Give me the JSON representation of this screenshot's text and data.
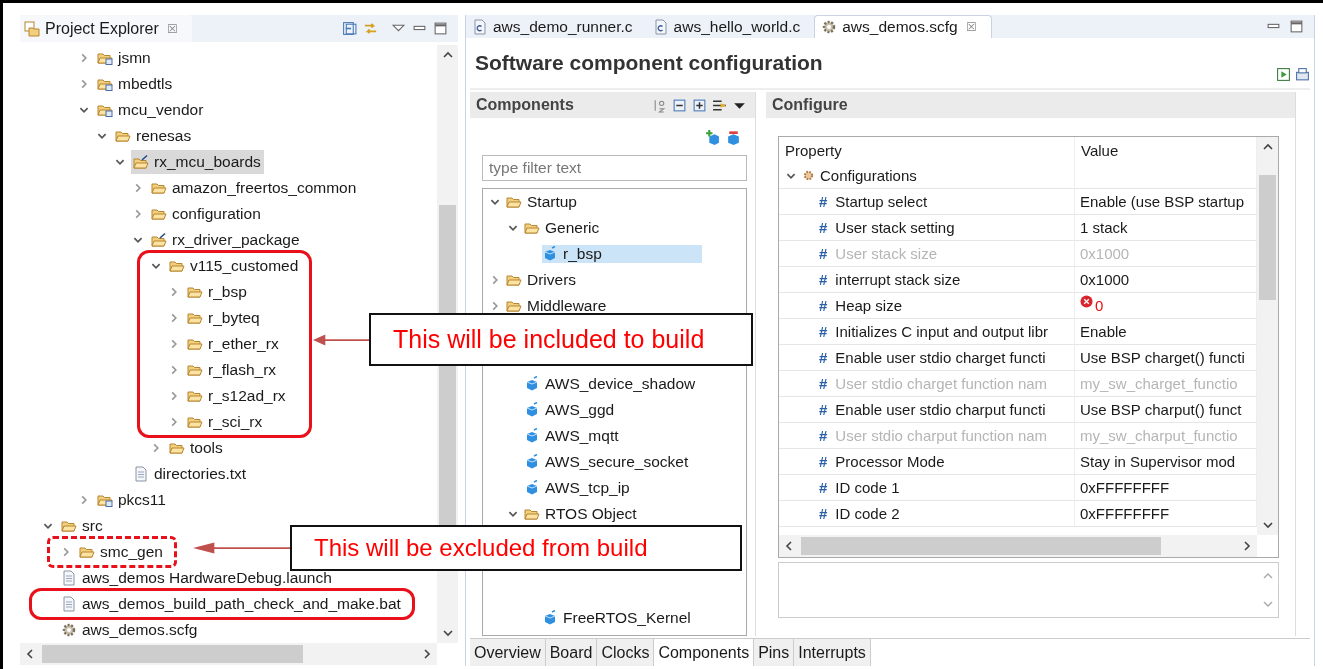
{
  "project_explorer": {
    "title": "Project Explorer",
    "close": "☒",
    "continued_branch": [
      {
        "label": "jsmn",
        "kind": "project",
        "expanded": false,
        "selected": false
      },
      {
        "label": "mbedtls",
        "kind": "project",
        "expanded": false,
        "selected": false
      },
      {
        "label": "mcu_vendor",
        "kind": "project",
        "expanded": true,
        "selected": false,
        "children": [
          {
            "label": "renesas",
            "kind": "folder",
            "expanded": true,
            "selected": false,
            "children": [
              {
                "label": "rx_mcu_boards",
                "kind": "linked",
                "expanded": true,
                "selected": true,
                "children": [
                  {
                    "label": "amazon_freertos_common",
                    "kind": "folder",
                    "expanded": false,
                    "selected": false
                  },
                  {
                    "label": "configuration",
                    "kind": "folder",
                    "expanded": false,
                    "selected": false
                  },
                  {
                    "label": "rx_driver_package",
                    "kind": "linked",
                    "expanded": true,
                    "selected": false,
                    "children": [
                      {
                        "label": "v115_customed",
                        "kind": "folder",
                        "expanded": true,
                        "selected": false,
                        "boxed": true,
                        "dashed": false,
                        "children": [
                          {
                            "label": "r_bsp",
                            "kind": "folder",
                            "expanded": false,
                            "selected": false
                          },
                          {
                            "label": "r_byteq",
                            "kind": "folder",
                            "expanded": false,
                            "selected": false
                          },
                          {
                            "label": "r_ether_rx",
                            "kind": "folder",
                            "expanded": false,
                            "selected": false
                          },
                          {
                            "label": "r_flash_rx",
                            "kind": "folder",
                            "expanded": false,
                            "selected": false
                          },
                          {
                            "label": "r_s12ad_rx",
                            "kind": "folder",
                            "expanded": false,
                            "selected": false
                          },
                          {
                            "label": "r_sci_rx",
                            "kind": "folder",
                            "expanded": false,
                            "selected": false
                          }
                        ]
                      },
                      {
                        "label": "tools",
                        "kind": "folder",
                        "expanded": false,
                        "selected": false
                      }
                    ]
                  }
                ]
              },
              {
                "label": "directories.txt",
                "kind": "file",
                "selected": false
              }
            ]
          }
        ]
      },
      {
        "label": "pkcs11",
        "kind": "project",
        "expanded": false,
        "selected": false
      }
    ],
    "tree": [
      {
        "label": "src",
        "kind": "folder",
        "expanded": true,
        "selected": false,
        "children": [
          {
            "label": "smc_gen",
            "kind": "folder",
            "expanded": false,
            "selected": false,
            "boxed": true,
            "dashed": true
          }
        ]
      },
      {
        "label": "aws_demos HardwareDebug.launch",
        "kind": "file",
        "selected": false
      },
      {
        "label": "aws_demos_build_path_check_and_make.bat",
        "kind": "file",
        "selected": false,
        "boxed": true,
        "dashed": false
      },
      {
        "label": "aws_demos.scfg",
        "kind": "config",
        "selected": false
      }
    ]
  },
  "editor": {
    "tabs": [
      {
        "label": "aws_demo_runner.c",
        "kind": "c-file",
        "selected": false
      },
      {
        "label": "aws_hello_world.c",
        "kind": "c-file",
        "selected": false
      },
      {
        "label": "aws_demos.scfg",
        "kind": "config",
        "selected": true,
        "close": "☒"
      }
    ],
    "title": "Software component configuration",
    "components": {
      "title": "Components",
      "filter": {
        "placeholder": "type filter text"
      },
      "tree": [
        {
          "label": "Startup",
          "kind": "folder",
          "expanded": true,
          "selected": false,
          "children": [
            {
              "label": "Generic",
              "kind": "folder",
              "expanded": true,
              "selected": false,
              "children": [
                {
                  "label": "r_bsp",
                  "kind": "component",
                  "selected": true
                }
              ]
            }
          ]
        },
        {
          "label": "Drivers",
          "kind": "folder",
          "expanded": false,
          "selected": false
        },
        {
          "label": "Middleware",
          "kind": "folder",
          "expanded": false,
          "selected": false
        }
      ],
      "continued_branch": [
        {
          "label": "AWS_device_shadow",
          "kind": "component",
          "selected": false
        },
        {
          "label": "AWS_ggd",
          "kind": "component",
          "selected": false
        },
        {
          "label": "AWS_mqtt",
          "kind": "component",
          "selected": false
        },
        {
          "label": "AWS_secure_socket",
          "kind": "component",
          "selected": false
        },
        {
          "label": "AWS_tcp_ip",
          "kind": "component",
          "selected": false
        },
        {
          "label": "RTOS Object",
          "kind": "folder",
          "expanded": true,
          "selected": false,
          "children": [
            {
              "label": "FreeRTOS_Kernel",
              "kind": "component",
              "selected": false
            }
          ]
        }
      ]
    },
    "configure": {
      "title": "Configure",
      "columns": [
        "Property",
        "Value"
      ],
      "group": {
        "label": "Configurations",
        "expanded": true
      },
      "rows": [
        {
          "marker": "#",
          "property": "Startup select",
          "value": "Enable (use BSP startup",
          "disabled": false,
          "error": false
        },
        {
          "marker": "#",
          "property": "User stack setting",
          "value": "1 stack",
          "disabled": false,
          "error": false
        },
        {
          "marker": "#",
          "property": "User stack size",
          "value": "0x1000",
          "disabled": true,
          "error": false
        },
        {
          "marker": "#",
          "property": "interrupt stack size",
          "value": "0x1000",
          "disabled": false,
          "error": false
        },
        {
          "marker": "#",
          "property": "Heap size",
          "value": "0",
          "disabled": false,
          "error": true
        },
        {
          "marker": "#",
          "property": "Initializes C input and output libr",
          "value": "Enable",
          "disabled": false,
          "error": false
        },
        {
          "marker": "#",
          "property": "Enable user stdio charget functi",
          "value": "Use BSP charget() functi",
          "disabled": false,
          "error": false
        },
        {
          "marker": "#",
          "property": "User stdio charget function nam",
          "value": "my_sw_charget_functio",
          "disabled": true,
          "error": false
        },
        {
          "marker": "#",
          "property": "Enable user stdio charput functi",
          "value": "Use BSP charput() funct",
          "disabled": false,
          "error": false
        },
        {
          "marker": "#",
          "property": "User stdio charput function nam",
          "value": "my_sw_charput_functio",
          "disabled": true,
          "error": false
        },
        {
          "marker": "#",
          "property": "Processor Mode",
          "value": "Stay in Supervisor mod",
          "disabled": false,
          "error": false
        },
        {
          "marker": "#",
          "property": "ID code 1",
          "value": "0xFFFFFFFF",
          "disabled": false,
          "error": false
        },
        {
          "marker": "#",
          "property": "ID code 2",
          "value": "0xFFFFFFFF",
          "disabled": false,
          "error": false
        }
      ]
    },
    "page_tabs": [
      {
        "label": "Overview",
        "selected": false
      },
      {
        "label": "Board",
        "selected": false
      },
      {
        "label": "Clocks",
        "selected": false
      },
      {
        "label": "Components",
        "selected": true
      },
      {
        "label": "Pins",
        "selected": false
      },
      {
        "label": "Interrupts",
        "selected": false
      }
    ]
  },
  "callouts": [
    {
      "text": "This will be included to build"
    },
    {
      "text": "This will be excluded from build"
    }
  ]
}
